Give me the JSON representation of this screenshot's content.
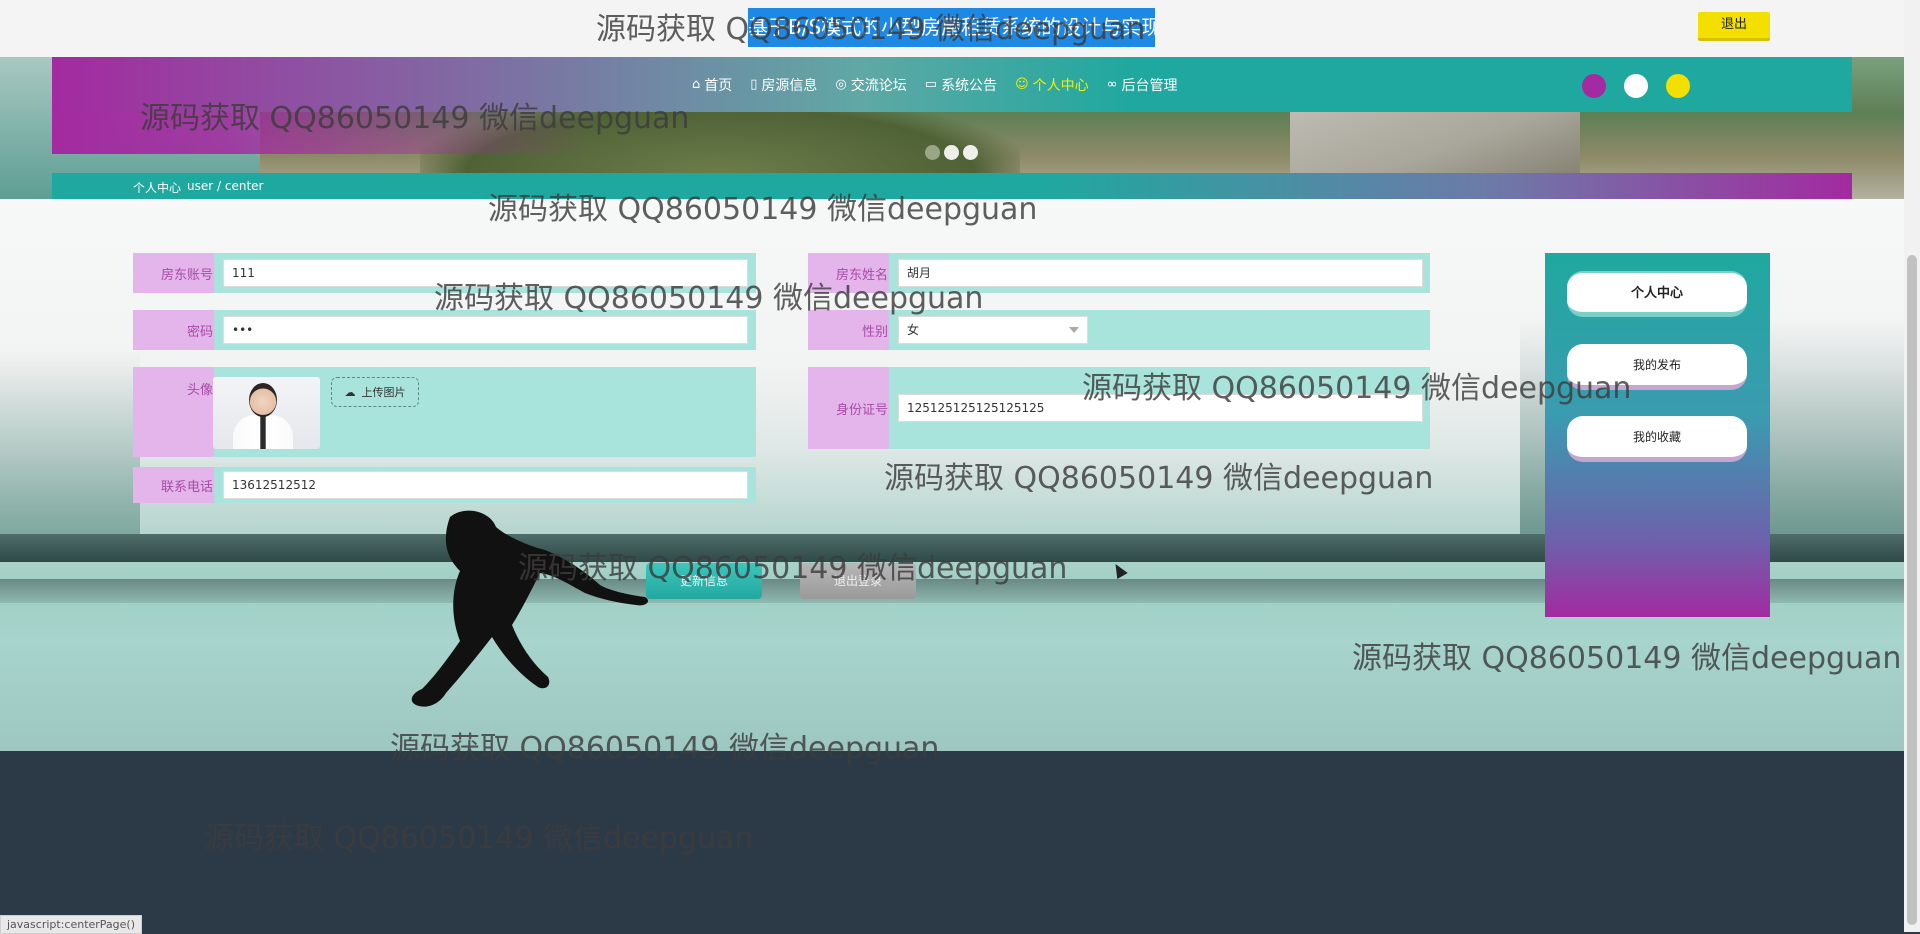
{
  "header": {
    "site_title": "基于B/S模式的小型房屋租赁系统的设计与实现",
    "logout_label": "退出"
  },
  "nav": {
    "items": [
      {
        "label": "首页",
        "icon": "home-icon"
      },
      {
        "label": "房源信息",
        "icon": "document-icon"
      },
      {
        "label": "交流论坛",
        "icon": "palette-icon"
      },
      {
        "label": "系统公告",
        "icon": "book-icon"
      },
      {
        "label": "个人中心",
        "icon": "user-icon",
        "active": true
      },
      {
        "label": "后台管理",
        "icon": "link-icon"
      }
    ],
    "active_color": "#f2f200"
  },
  "theme_colors": [
    "#a32aa0",
    "#ffffff",
    "#f4e000"
  ],
  "breadcrumb": {
    "current": "个人中心",
    "path": "user / center"
  },
  "form": {
    "account": {
      "label": "房东账号",
      "value": "111"
    },
    "name": {
      "label": "房东姓名",
      "value": "胡月"
    },
    "password": {
      "label": "密码",
      "value": "•••"
    },
    "gender": {
      "label": "性别",
      "value": "女"
    },
    "avatar": {
      "label": "头像",
      "upload_label": "上传图片"
    },
    "id_card": {
      "label": "身份证号",
      "value": "125125125125125125"
    },
    "phone": {
      "label": "联系电话",
      "value": "13612512512"
    }
  },
  "actions": {
    "update_label": "更新信息",
    "logout_label": "退出登录"
  },
  "sidebar": {
    "items": [
      {
        "label": "个人中心",
        "active": true
      },
      {
        "label": "我的发布"
      },
      {
        "label": "我的收藏"
      }
    ]
  },
  "watermark": "源码获取 QQ86050149 微信deepguan",
  "statusbar": "javascript:centerPage()",
  "colors": {
    "accent_teal": "#1fa89f",
    "accent_purple": "#a32aa0",
    "label_pink": "#e3b5eb",
    "footer": "#2c3a48"
  }
}
